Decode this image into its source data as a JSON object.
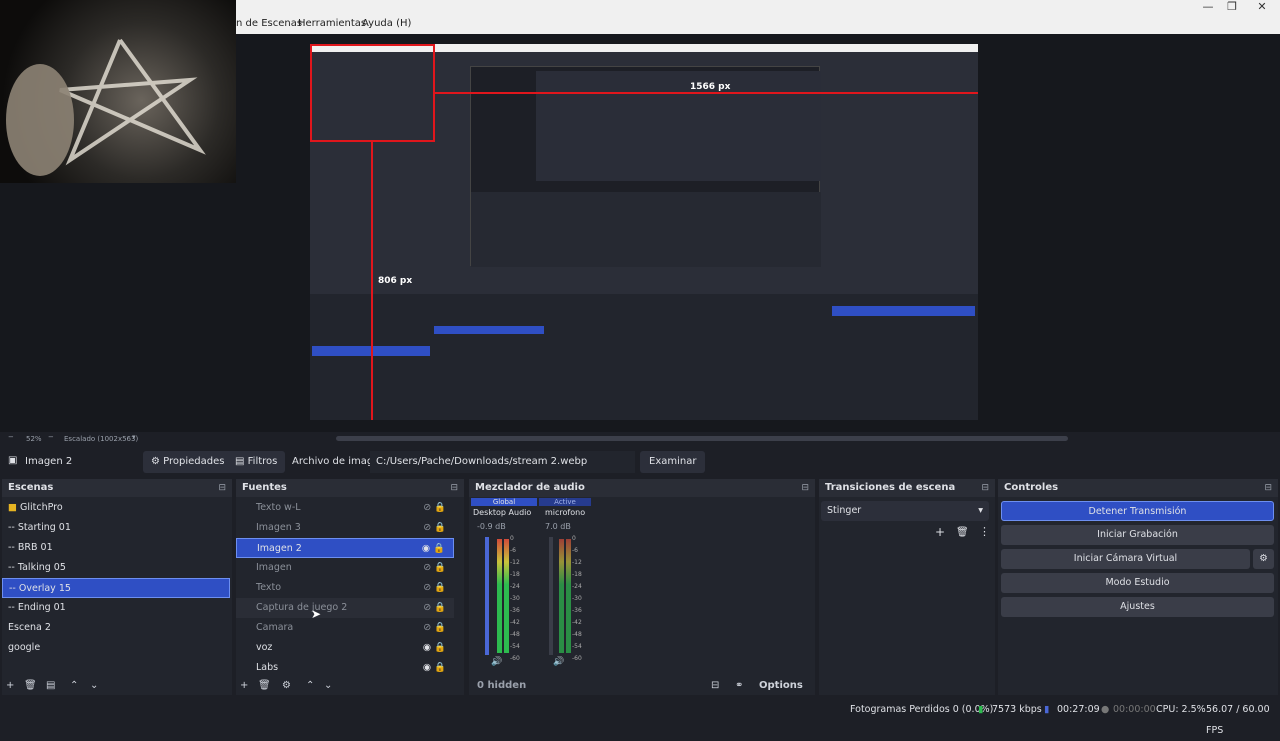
{
  "menu": {
    "scenes_menu": "n de Escenas",
    "tools": "Herramientas",
    "help": "Ayuda (H)"
  },
  "window": {
    "minimize": "—",
    "restore": "❐",
    "close": "✕"
  },
  "preview": {
    "dimension_h": "1566 px",
    "dimension_v": "806 px"
  },
  "zoom": {
    "percent": "52%",
    "scale": "Escalado (1002x563)"
  },
  "props": {
    "source": "Imagen 2",
    "properties": "Propiedades",
    "filters": "Filtros",
    "file_label": "Archivo de imagen",
    "path": "C:/Users/Pache/Downloads/stream 2.webp",
    "browse": "Examinar"
  },
  "scenes": {
    "title": "Escenas",
    "items": [
      "GlitchPro",
      "-- Starting 01",
      "-- BRB 01",
      "-- Talking 05",
      "-- Overlay 15",
      "-- Ending 01",
      "Escena 2",
      "google"
    ],
    "selected": 4
  },
  "sources": {
    "title": "Fuentes",
    "items": [
      "Texto w-L",
      "Imagen 3",
      "Imagen 2",
      "Imagen",
      "Texto",
      "Captura de juego 2",
      "Camara",
      "voz",
      "Labs"
    ],
    "selected": 2
  },
  "mixer": {
    "title": "Mezclador de audio",
    "tab_global": "Global",
    "tab_active": "Active",
    "ch1": {
      "name": "Desktop Audio",
      "db": "-0.9 dB"
    },
    "ch2": {
      "name": "microfono",
      "db": "7.0 dB"
    },
    "ticks": [
      "0",
      "-6",
      "-12",
      "-18",
      "-24",
      "-30",
      "-36",
      "-42",
      "-48",
      "-54",
      "-60"
    ],
    "hidden": "0 hidden",
    "options": "Options"
  },
  "transitions": {
    "title": "Transiciones de escena",
    "current": "Stinger"
  },
  "controls": {
    "title": "Controles",
    "stop_stream": "Detener Transmisión",
    "start_rec": "Iniciar Grabación",
    "start_vcam": "Iniciar Cámara Virtual",
    "studio": "Modo Estudio",
    "settings": "Ajustes"
  },
  "status": {
    "dropped": "Fotogramas Perdidos 0 (0.0%)",
    "kbps": "7573 kbps",
    "stream_time": "00:27:09",
    "rec_time": "00:00:00",
    "cpu": "CPU: 2.5%",
    "fps": "56.07 / 60.00 FPS"
  },
  "colors": {
    "accent": "#2f4fc4",
    "red": "#e0161c"
  }
}
